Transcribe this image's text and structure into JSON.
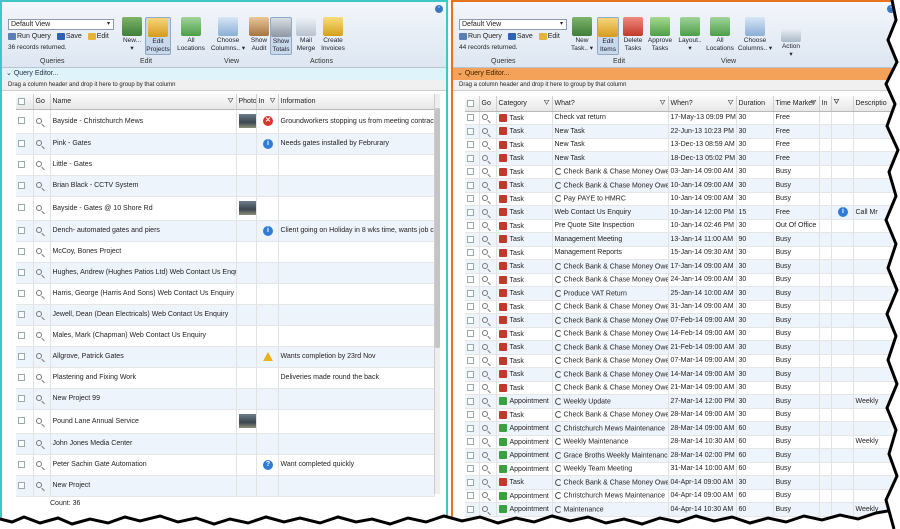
{
  "left": {
    "view_select": "Default View",
    "run_query": "Run Query",
    "save": "Save",
    "edit": "Edit",
    "records": "36 records returned.",
    "groups": {
      "queries": "Queries",
      "edit": "Edit",
      "view": "View",
      "actions": "Actions"
    },
    "buttons": [
      {
        "label": "New...",
        "sub": "▾"
      },
      {
        "label": "Edit",
        "sub": "Projects"
      },
      {
        "label": "All",
        "sub": "Locations"
      },
      {
        "label": "Choose",
        "sub": "Columns.. ▾"
      },
      {
        "label": "Show",
        "sub": "Audit"
      },
      {
        "label": "Show",
        "sub": "Totals"
      },
      {
        "label": "Mail",
        "sub": "Merge"
      },
      {
        "label": "Create",
        "sub": "Invoices"
      }
    ],
    "query_editor": "Query Editor...",
    "drag_hint": "Drag a column header and drop it here to group by that column",
    "columns": {
      "go": "Go",
      "name": "Name",
      "photo": "Photo",
      "in": "In",
      "info": "Information"
    },
    "rows": [
      {
        "name": "Bayside - Christchurch Mews",
        "photo": true,
        "status": "error",
        "info": "Groundworkers stopping us from meeting contract"
      },
      {
        "name": "Pink - Gates",
        "photo": false,
        "status": "info",
        "info": "Needs gates installed by Februrary"
      },
      {
        "name": "Little - Gates",
        "photo": false,
        "status": "",
        "info": ""
      },
      {
        "name": "Brian Black - CCTV System",
        "photo": false,
        "status": "",
        "info": ""
      },
      {
        "name": "Bayside - Gates @ 10 Shore Rd",
        "photo": true,
        "status": "",
        "info": ""
      },
      {
        "name": "Dench- automated gates and piers",
        "photo": false,
        "status": "info",
        "info": "Client going on Holiday in 8 wks time, wants job co"
      },
      {
        "name": "McCoy, Bones Project",
        "photo": false,
        "status": "",
        "info": ""
      },
      {
        "name": "Hughes, Andrew (Hughes Patios Ltd) Web Contact Us Enquiry",
        "photo": false,
        "status": "",
        "info": ""
      },
      {
        "name": "Harris, George (Harris And Sons) Web Contact Us Enquiry",
        "photo": false,
        "status": "",
        "info": ""
      },
      {
        "name": "Jewell, Dean (Dean Electricals) Web Contact Us Enquiry",
        "photo": false,
        "status": "",
        "info": ""
      },
      {
        "name": "Males, Mark (Chapman) Web Contact Us Enquiry",
        "photo": false,
        "status": "",
        "info": ""
      },
      {
        "name": "Allgrove, Patrick Gates",
        "photo": false,
        "status": "warning",
        "info": "Wants completion by 23rd Nov"
      },
      {
        "name": "Plastering and Fixing Work",
        "photo": false,
        "status": "",
        "info": "Deliveries made round the back"
      },
      {
        "name": "New Project 99",
        "photo": false,
        "status": "",
        "info": ""
      },
      {
        "name": "Pound Lane Annual Service",
        "photo": true,
        "status": "",
        "info": ""
      },
      {
        "name": "John Jones Media Center",
        "photo": false,
        "status": "",
        "info": ""
      },
      {
        "name": "Peter Sachin Gate Automation",
        "photo": false,
        "status": "help",
        "info": "Want completed quickly"
      },
      {
        "name": "New Project",
        "photo": false,
        "status": "",
        "info": ""
      }
    ],
    "footer_count": "Count: 36"
  },
  "right": {
    "view_select": "Default View",
    "run_query": "Run Query",
    "save": "Save",
    "edit": "Edit",
    "records": "44 records returned.",
    "groups": {
      "queries": "Queries",
      "edit": "Edit",
      "view": "View"
    },
    "buttons": [
      {
        "label": "New",
        "sub": "Task.. ▾"
      },
      {
        "label": "Edit",
        "sub": "Items"
      },
      {
        "label": "Delete",
        "sub": "Tasks"
      },
      {
        "label": "Approve",
        "sub": "Tasks"
      },
      {
        "label": "Layout..",
        "sub": "▾"
      },
      {
        "label": "All",
        "sub": "Locations"
      },
      {
        "label": "Choose",
        "sub": "Columns.. ▾"
      },
      {
        "label": "Action",
        "sub": "▾"
      }
    ],
    "query_editor": "Query Editor...",
    "drag_hint": "Drag a column header and drop it here to group by that column",
    "columns": {
      "go": "Go",
      "category": "Category",
      "what": "What?",
      "when": "When?",
      "duration": "Duration",
      "time_marker": "Time Marker",
      "in": "In",
      "description": "Descriptio"
    },
    "rows": [
      {
        "cat": "Task",
        "recur": false,
        "what": "Check vat return",
        "when": "17-May-13 09:09 PM",
        "dur": "30",
        "tm": "Free",
        "info": false,
        "desc": ""
      },
      {
        "cat": "Task",
        "recur": false,
        "what": "New Task",
        "when": "22-Jun-13 10:23 PM",
        "dur": "30",
        "tm": "Free",
        "info": false,
        "desc": ""
      },
      {
        "cat": "Task",
        "recur": false,
        "what": "New Task",
        "when": "13-Dec-13 08:59 AM",
        "dur": "30",
        "tm": "Free",
        "info": false,
        "desc": ""
      },
      {
        "cat": "Task",
        "recur": false,
        "what": "New Task",
        "when": "18-Dec-13 05:02 PM",
        "dur": "30",
        "tm": "Free",
        "info": false,
        "desc": ""
      },
      {
        "cat": "Task",
        "recur": true,
        "what": "Check Bank & Chase Money Owed",
        "when": "03-Jan-14 09:00 AM",
        "dur": "30",
        "tm": "Busy",
        "info": false,
        "desc": ""
      },
      {
        "cat": "Task",
        "recur": true,
        "what": "Check Bank & Chase Money Owed",
        "when": "10-Jan-14 09:00 AM",
        "dur": "30",
        "tm": "Busy",
        "info": false,
        "desc": ""
      },
      {
        "cat": "Task",
        "recur": true,
        "what": "Pay PAYE to HMRC",
        "when": "10-Jan-14 09:00 AM",
        "dur": "30",
        "tm": "Busy",
        "info": false,
        "desc": ""
      },
      {
        "cat": "Task",
        "recur": false,
        "what": "Web Contact Us Enquiry",
        "when": "10-Jan-14 12:00 PM",
        "dur": "15",
        "tm": "Free",
        "info": true,
        "desc": "Call Mr"
      },
      {
        "cat": "Task",
        "recur": false,
        "what": "Pre Quote Site Inspection",
        "when": "10-Jan-14 02:46 PM",
        "dur": "30",
        "tm": "Out Of Office",
        "info": false,
        "desc": ""
      },
      {
        "cat": "Task",
        "recur": false,
        "what": "Management Meeting",
        "when": "13-Jan-14 11:00 AM",
        "dur": "90",
        "tm": "Busy",
        "info": false,
        "desc": ""
      },
      {
        "cat": "Task",
        "recur": false,
        "what": "Management Reports",
        "when": "15-Jan-14 09:30 AM",
        "dur": "30",
        "tm": "Busy",
        "info": false,
        "desc": ""
      },
      {
        "cat": "Task",
        "recur": true,
        "what": "Check Bank & Chase Money Owed",
        "when": "17-Jan-14 09:00 AM",
        "dur": "30",
        "tm": "Busy",
        "info": false,
        "desc": ""
      },
      {
        "cat": "Task",
        "recur": true,
        "what": "Check Bank & Chase Money Owed",
        "when": "24-Jan-14 09:00 AM",
        "dur": "30",
        "tm": "Busy",
        "info": false,
        "desc": ""
      },
      {
        "cat": "Task",
        "recur": true,
        "what": "Produce VAT Return",
        "when": "25-Jan-14 10:00 AM",
        "dur": "30",
        "tm": "Busy",
        "info": false,
        "desc": ""
      },
      {
        "cat": "Task",
        "recur": true,
        "what": "Check Bank & Chase Money Owed",
        "when": "31-Jan-14 09:00 AM",
        "dur": "30",
        "tm": "Busy",
        "info": false,
        "desc": ""
      },
      {
        "cat": "Task",
        "recur": true,
        "what": "Check Bank & Chase Money Owed",
        "when": "07-Feb-14 09:00 AM",
        "dur": "30",
        "tm": "Busy",
        "info": false,
        "desc": ""
      },
      {
        "cat": "Task",
        "recur": true,
        "what": "Check Bank & Chase Money Owed",
        "when": "14-Feb-14 09:00 AM",
        "dur": "30",
        "tm": "Busy",
        "info": false,
        "desc": ""
      },
      {
        "cat": "Task",
        "recur": true,
        "what": "Check Bank & Chase Money Owed",
        "when": "21-Feb-14 09:00 AM",
        "dur": "30",
        "tm": "Busy",
        "info": false,
        "desc": ""
      },
      {
        "cat": "Task",
        "recur": true,
        "what": "Check Bank & Chase Money Owed",
        "when": "07-Mar-14 09:00 AM",
        "dur": "30",
        "tm": "Busy",
        "info": false,
        "desc": ""
      },
      {
        "cat": "Task",
        "recur": true,
        "what": "Check Bank & Chase Money Owed",
        "when": "14-Mar-14 09:00 AM",
        "dur": "30",
        "tm": "Busy",
        "info": false,
        "desc": ""
      },
      {
        "cat": "Task",
        "recur": true,
        "what": "Check Bank & Chase Money Owed",
        "when": "21-Mar-14 09:00 AM",
        "dur": "30",
        "tm": "Busy",
        "info": false,
        "desc": ""
      },
      {
        "cat": "Appointment",
        "recur": true,
        "what": "Weekly Update",
        "when": "27-Mar-14 12:00 PM",
        "dur": "30",
        "tm": "Busy",
        "info": false,
        "desc": "Weekly"
      },
      {
        "cat": "Task",
        "recur": true,
        "what": "Check Bank & Chase Money Owed",
        "when": "28-Mar-14 09:00 AM",
        "dur": "30",
        "tm": "Busy",
        "info": false,
        "desc": ""
      },
      {
        "cat": "Appointment",
        "recur": true,
        "what": "Christchurch Mews Maintenance",
        "when": "28-Mar-14 09:00 AM",
        "dur": "60",
        "tm": "Busy",
        "info": false,
        "desc": ""
      },
      {
        "cat": "Appointment",
        "recur": true,
        "what": "Weekly Maintenance",
        "when": "28-Mar-14 10:30 AM",
        "dur": "60",
        "tm": "Busy",
        "info": false,
        "desc": "Weekly"
      },
      {
        "cat": "Appointment",
        "recur": true,
        "what": "Grace Broths Weekly Maintenance",
        "when": "28-Mar-14 02:00 PM",
        "dur": "60",
        "tm": "Busy",
        "info": false,
        "desc": ""
      },
      {
        "cat": "Appointment",
        "recur": true,
        "what": "Weekly Team Meeting",
        "when": "31-Mar-14 10:00 AM",
        "dur": "60",
        "tm": "Busy",
        "info": false,
        "desc": ""
      },
      {
        "cat": "Task",
        "recur": true,
        "what": "Check Bank & Chase Money Owed",
        "when": "04-Apr-14 09:00 AM",
        "dur": "30",
        "tm": "Busy",
        "info": false,
        "desc": ""
      },
      {
        "cat": "Appointment",
        "recur": true,
        "what": "Christchurch Mews Maintenance",
        "when": "04-Apr-14 09:00 AM",
        "dur": "60",
        "tm": "Busy",
        "info": false,
        "desc": ""
      },
      {
        "cat": "Appointment",
        "recur": true,
        "what": "Maintenance",
        "when": "04-Apr-14 10:30 AM",
        "dur": "60",
        "tm": "Busy",
        "info": false,
        "desc": "Weekly"
      }
    ]
  },
  "colors": {
    "left_border": "#3fc6c6",
    "right_border": "#e8731e",
    "task": "#c0392b",
    "appointment": "#3aa141",
    "query_bar_left": "#dff3fb",
    "query_bar_right": "#f4a259"
  }
}
